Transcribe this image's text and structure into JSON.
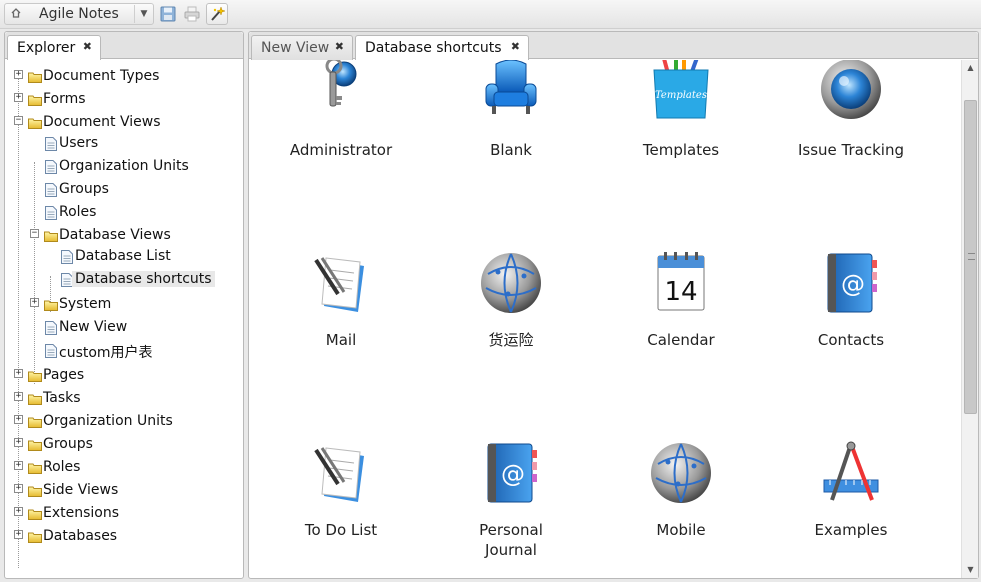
{
  "app": {
    "title": "Agile Notes"
  },
  "toolbar": {
    "icons": [
      "home-icon",
      "save-icon",
      "print-icon",
      "magic-wand-icon"
    ]
  },
  "left_panel": {
    "tab": {
      "label": "Explorer"
    },
    "tree": {
      "document_types": "Document Types",
      "forms": "Forms",
      "document_views": "Document Views",
      "users": "Users",
      "organization_units_view": "Organization Units",
      "groups_view": "Groups",
      "roles_view": "Roles",
      "database_views": "Database Views",
      "database_list": "Database List",
      "database_shortcuts": "Database shortcuts",
      "system": "System",
      "new_view": "New View",
      "custom_table": "custom用户表",
      "pages": "Pages",
      "tasks": "Tasks",
      "organization_units": "Organization Units",
      "groups": "Groups",
      "roles": "Roles",
      "side_views": "Side Views",
      "extensions": "Extensions",
      "databases": "Databases"
    }
  },
  "right_panel": {
    "tabs": [
      {
        "label": "New View"
      },
      {
        "label": "Database shortcuts"
      }
    ],
    "shortcuts": [
      {
        "label": "Administrator"
      },
      {
        "label": "Blank"
      },
      {
        "label": "Templates",
        "icon_text": "Templates"
      },
      {
        "label": "Issue Tracking"
      },
      {
        "label": "Mail"
      },
      {
        "label": "货运险"
      },
      {
        "label": "Calendar",
        "icon_text": "14"
      },
      {
        "label": "Contacts",
        "icon_text": "@"
      },
      {
        "label": "To Do List"
      },
      {
        "label": "Personal Journal",
        "icon_text": "@"
      },
      {
        "label": "Mobile"
      },
      {
        "label": "Examples"
      }
    ]
  }
}
